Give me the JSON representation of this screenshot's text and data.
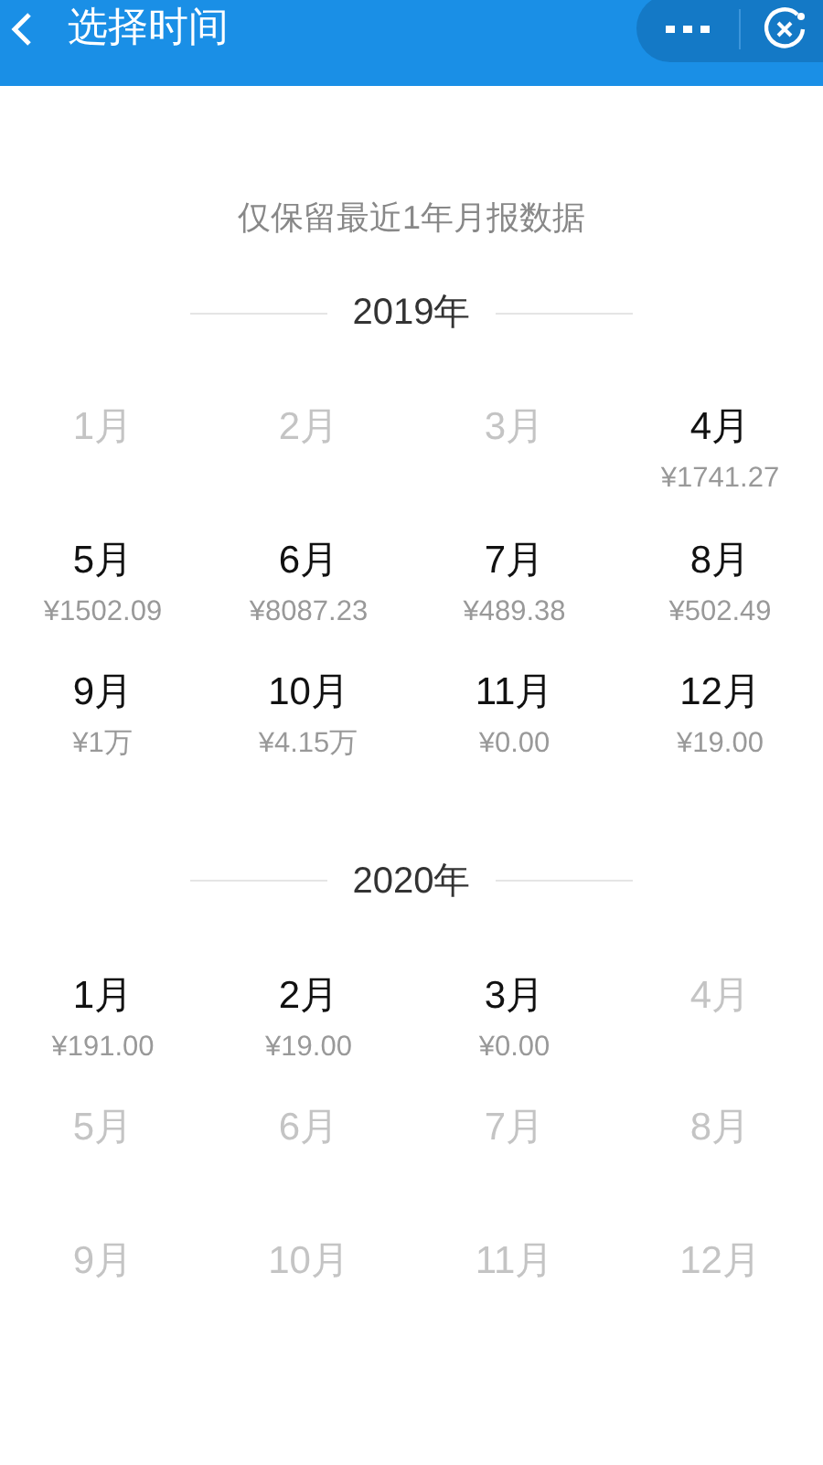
{
  "header": {
    "title": "选择时间"
  },
  "notice": "仅保留最近1年月报数据",
  "years": [
    {
      "label": "2019年",
      "months": [
        {
          "label": "1月",
          "disabled": true
        },
        {
          "label": "2月",
          "disabled": true
        },
        {
          "label": "3月",
          "disabled": true
        },
        {
          "label": "4月",
          "disabled": false,
          "amount": "¥1741.27"
        },
        {
          "label": "5月",
          "disabled": false,
          "amount": "¥1502.09"
        },
        {
          "label": "6月",
          "disabled": false,
          "amount": "¥8087.23"
        },
        {
          "label": "7月",
          "disabled": false,
          "amount": "¥489.38"
        },
        {
          "label": "8月",
          "disabled": false,
          "amount": "¥502.49"
        },
        {
          "label": "9月",
          "disabled": false,
          "amount": "¥1万"
        },
        {
          "label": "10月",
          "disabled": false,
          "amount": "¥4.15万"
        },
        {
          "label": "11月",
          "disabled": false,
          "amount": "¥0.00"
        },
        {
          "label": "12月",
          "disabled": false,
          "amount": "¥19.00"
        }
      ]
    },
    {
      "label": "2020年",
      "months": [
        {
          "label": "1月",
          "disabled": false,
          "amount": "¥191.00"
        },
        {
          "label": "2月",
          "disabled": false,
          "amount": "¥19.00"
        },
        {
          "label": "3月",
          "disabled": false,
          "amount": "¥0.00"
        },
        {
          "label": "4月",
          "disabled": true
        },
        {
          "label": "5月",
          "disabled": true
        },
        {
          "label": "6月",
          "disabled": true
        },
        {
          "label": "7月",
          "disabled": true
        },
        {
          "label": "8月",
          "disabled": true
        },
        {
          "label": "9月",
          "disabled": true
        },
        {
          "label": "10月",
          "disabled": true
        },
        {
          "label": "11月",
          "disabled": true
        },
        {
          "label": "12月",
          "disabled": true
        }
      ]
    }
  ]
}
